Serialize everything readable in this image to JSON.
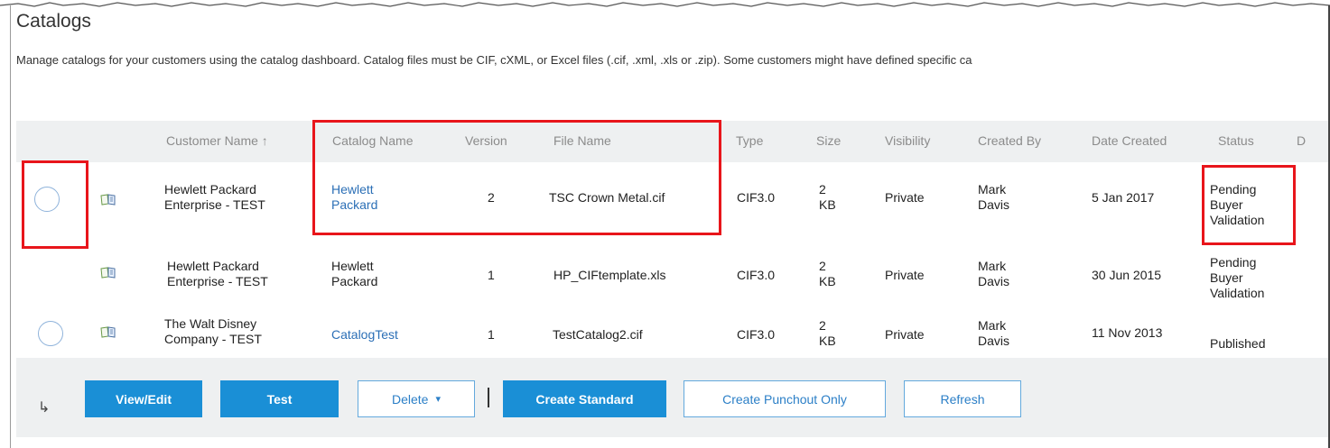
{
  "page": {
    "title": "Catalogs",
    "description": "Manage catalogs for your customers using the catalog dashboard. Catalog files must be CIF, cXML, or Excel files (.cif, .xml, .xls or .zip). Some customers might have defined specific ca"
  },
  "table": {
    "columns": [
      "Customer Name ↑",
      "Catalog Name",
      "Version",
      "File Name",
      "Type",
      "Size",
      "Visibility",
      "Created By",
      "Date Created",
      "Status",
      "D"
    ],
    "rows": [
      {
        "customer": [
          "Hewlett Packard",
          "Enterprise - TEST"
        ],
        "catalog": [
          "Hewlett",
          "Packard"
        ],
        "version": "2",
        "file": "TSC Crown Metal.cif",
        "type": "CIF3.0",
        "size": [
          "2",
          "KB"
        ],
        "visibility": "Private",
        "created_by": [
          "Mark",
          "Davis"
        ],
        "date": "5 Jan 2017",
        "status": [
          "Pending",
          "Buyer",
          "Validation"
        ]
      },
      {
        "customer": [
          "Hewlett Packard",
          "Enterprise - TEST"
        ],
        "catalog": [
          "Hewlett",
          "Packard"
        ],
        "version": "1",
        "file": "HP_CIFtemplate.xls",
        "type": "CIF3.0",
        "size": [
          "2",
          "KB"
        ],
        "visibility": "Private",
        "created_by": [
          "Mark",
          "Davis"
        ],
        "date": "30 Jun 2015",
        "status": [
          "Pending",
          "Buyer",
          "Validation"
        ]
      },
      {
        "customer": [
          "The Walt Disney",
          "Company - TEST"
        ],
        "catalog": "CatalogTest",
        "version": "1",
        "file": "TestCatalog2.cif",
        "type": "CIF3.0",
        "size": [
          "2",
          "KB"
        ],
        "visibility": "Private",
        "created_by": [
          "Mark",
          "Davis"
        ],
        "date": "11 Nov 2013",
        "status": "Published"
      }
    ]
  },
  "actions": {
    "arrow": "↳",
    "view_edit": "View/Edit",
    "test": "Test",
    "delete": "Delete",
    "delete_caret": "▾",
    "create_standard": "Create Standard",
    "create_punchout": "Create Punchout Only",
    "refresh": "Refresh"
  },
  "icons": {
    "catalog_row": "catalog-book-icon",
    "radio": "radio-button"
  },
  "colors": {
    "primary_button": "#1a8fd6",
    "link": "#2b6fb6",
    "highlight_box": "#e8151b",
    "header_bg": "#eef0f1"
  }
}
